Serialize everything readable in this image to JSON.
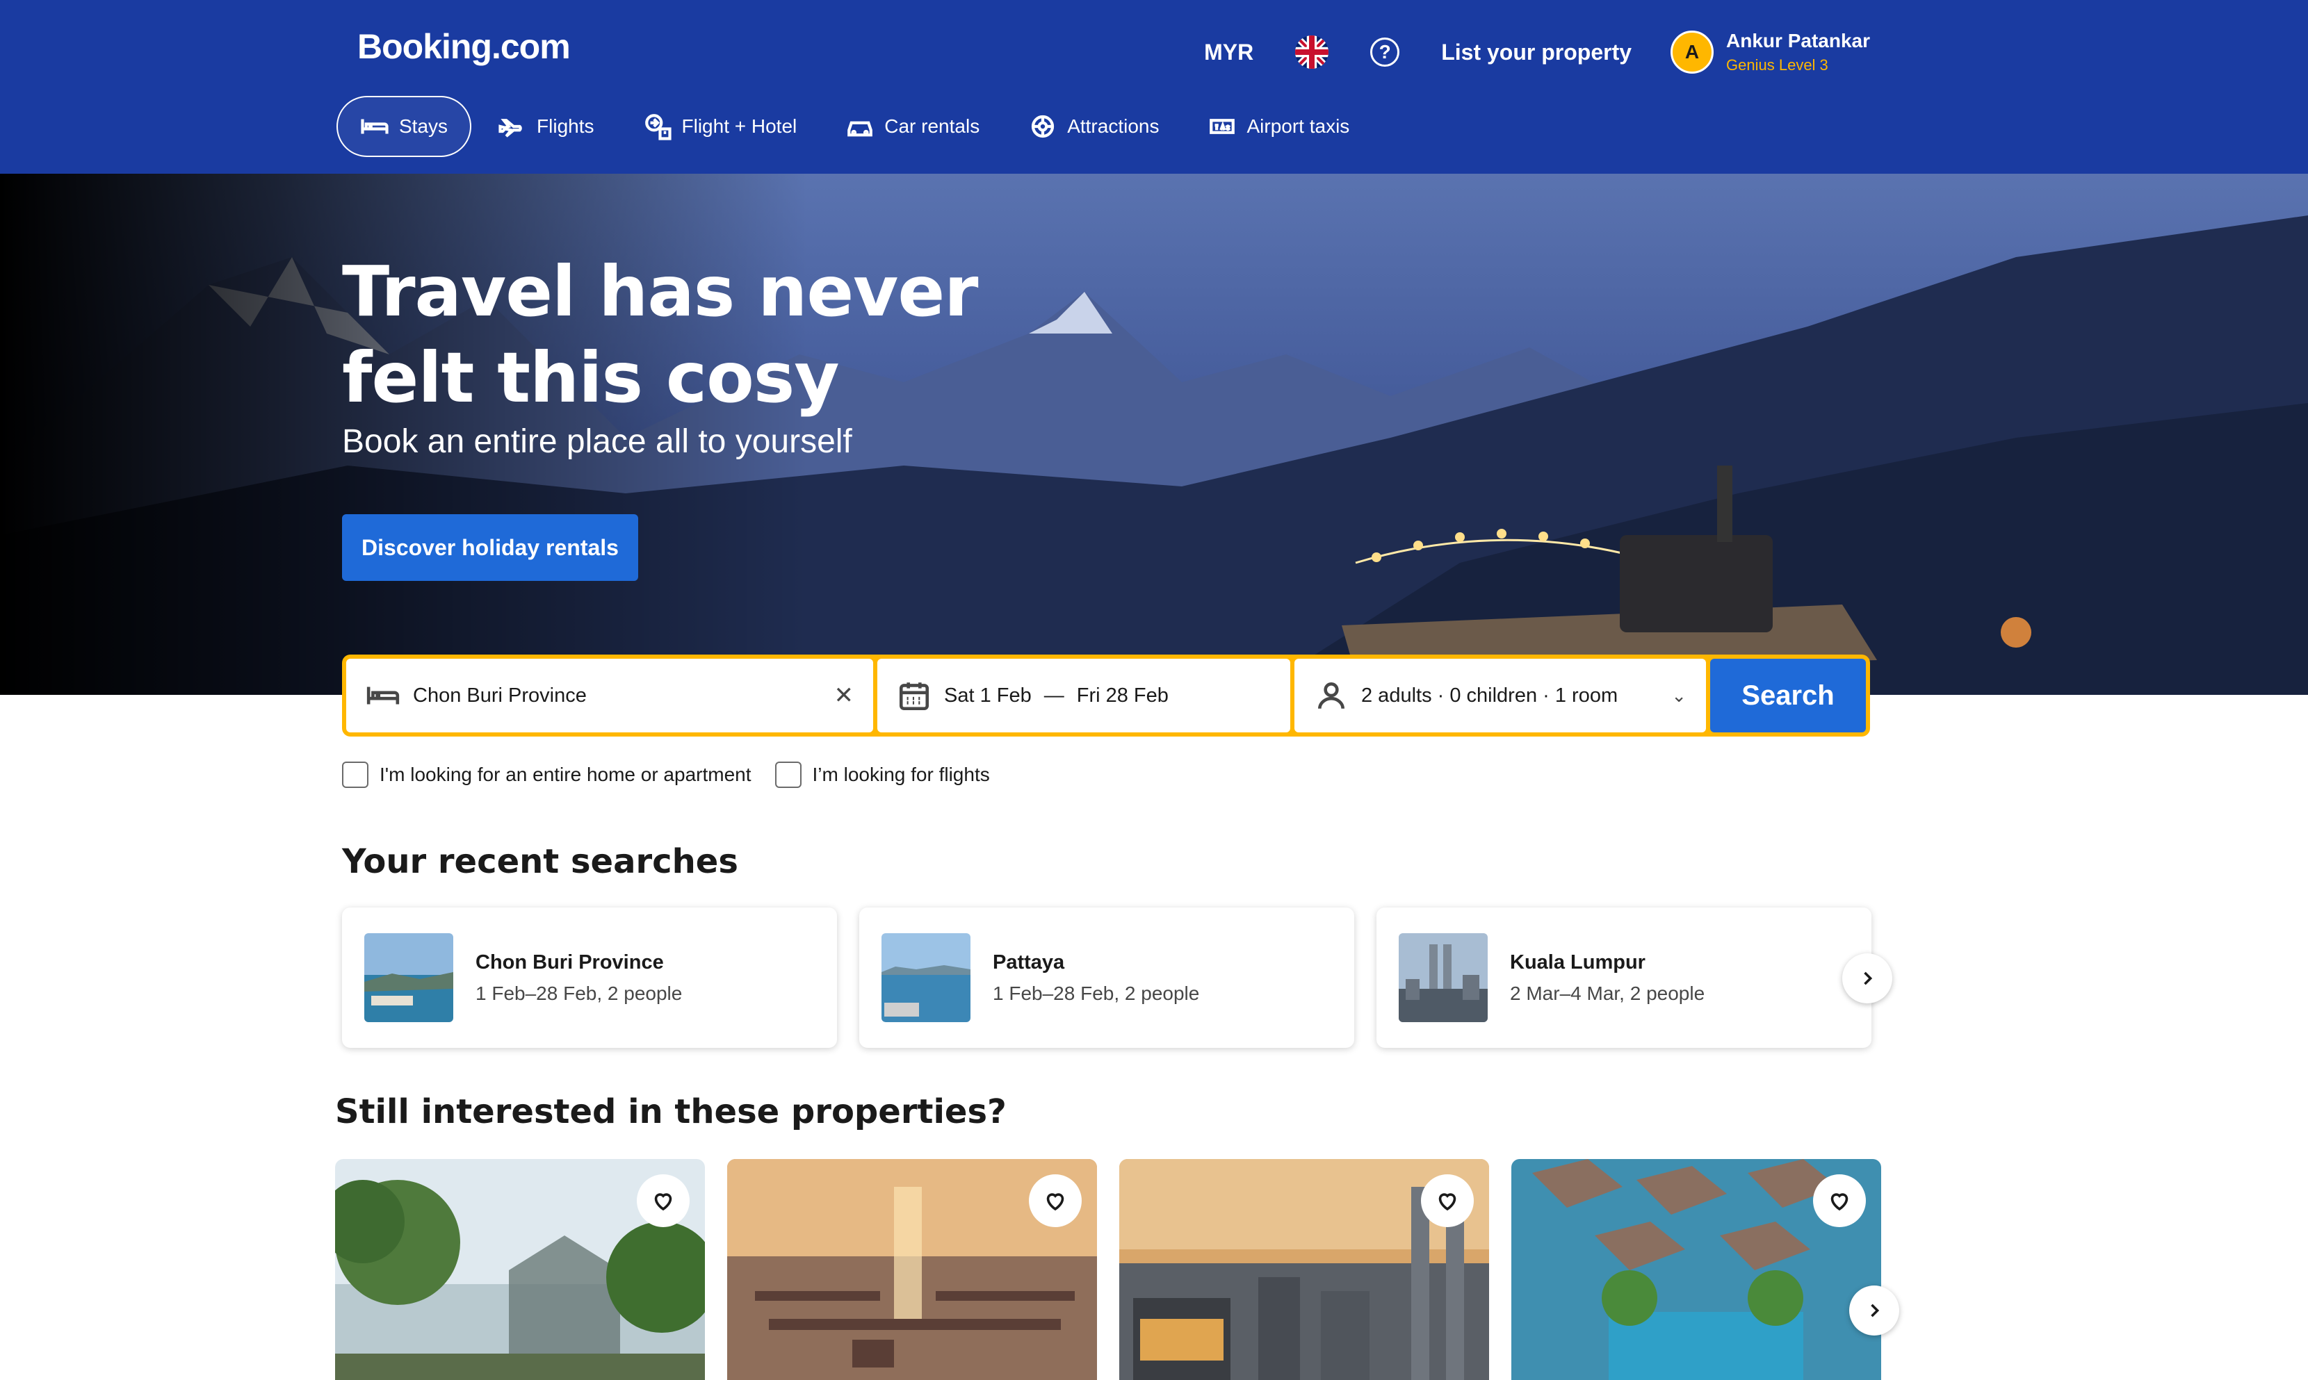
{
  "header": {
    "logo": "Booking.com",
    "currency": "MYR",
    "list_property": "List your property",
    "user": {
      "initial": "A",
      "name": "Ankur Patankar",
      "level": "Genius Level 3"
    }
  },
  "nav": [
    {
      "label": "Stays",
      "icon": "bed-icon",
      "active": true
    },
    {
      "label": "Flights",
      "icon": "plane-icon",
      "active": false
    },
    {
      "label": "Flight + Hotel",
      "icon": "flight-hotel-icon",
      "active": false
    },
    {
      "label": "Car rentals",
      "icon": "car-icon",
      "active": false
    },
    {
      "label": "Attractions",
      "icon": "attractions-icon",
      "active": false
    },
    {
      "label": "Airport taxis",
      "icon": "taxi-icon",
      "active": false
    }
  ],
  "hero": {
    "title": "Travel has never felt this cosy",
    "subtitle": "Book an entire place all to yourself",
    "button": "Discover holiday rentals"
  },
  "search": {
    "destination": "Chon Buri Province",
    "check_in": "Sat 1 Feb",
    "check_out": "Fri 28 Feb",
    "dash": "—",
    "guests": "2 adults · 0 children · 1 room",
    "button": "Search"
  },
  "checkboxes": {
    "entire_home": "I'm looking for an entire home or apartment",
    "flights": "I’m looking for flights"
  },
  "recent": {
    "title": "Your recent searches",
    "items": [
      {
        "title": "Chon Buri Province",
        "detail": "1 Feb–28 Feb, 2 people"
      },
      {
        "title": "Pattaya",
        "detail": "1 Feb–28 Feb, 2 people"
      },
      {
        "title": "Kuala Lumpur",
        "detail": "2 Mar–4 Mar, 2 people"
      }
    ]
  },
  "properties": {
    "title": "Still interested in these properties?"
  },
  "colors": {
    "brand_blue": "#1a3ba1",
    "action_blue": "#1f6ad8",
    "search_yellow": "#ffb700"
  }
}
